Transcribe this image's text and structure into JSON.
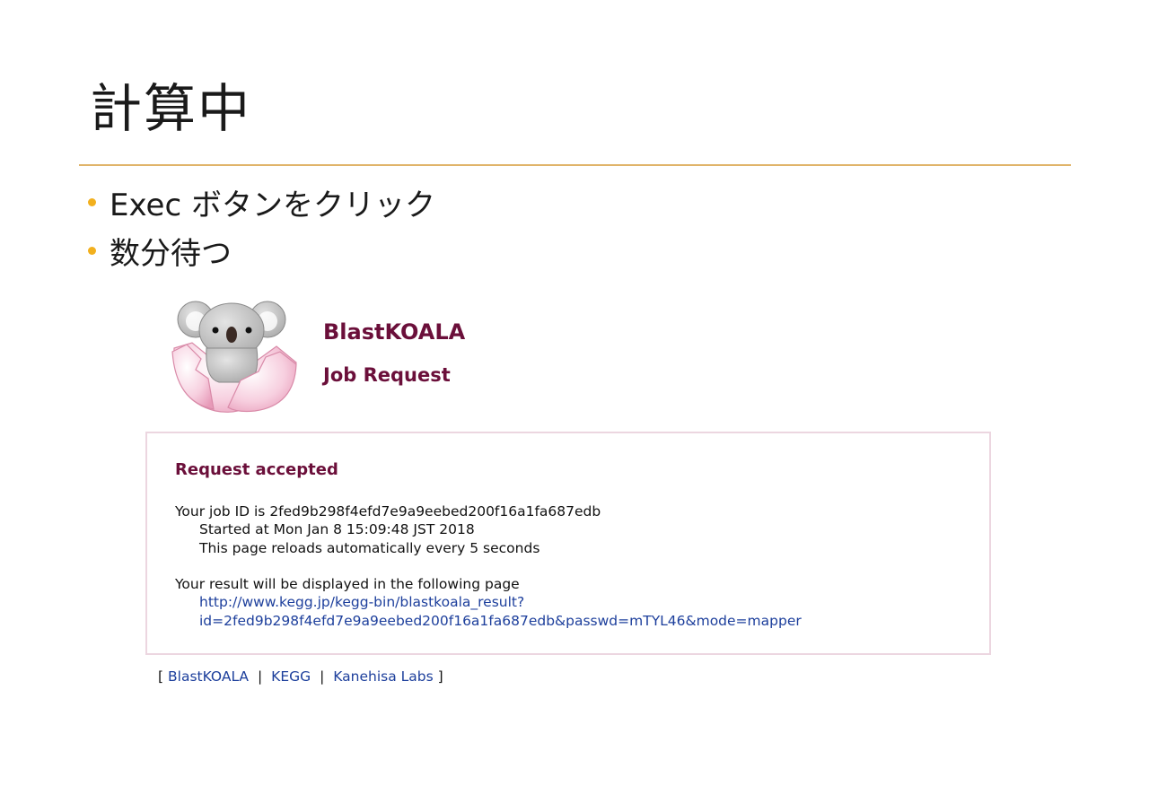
{
  "slide": {
    "title": "計算中",
    "bullets": [
      "Exec ボタンをクリック",
      "数分待つ"
    ]
  },
  "app": {
    "name": "BlastKOALA",
    "page": "Job Request",
    "logo_icon": "koala-egg-icon"
  },
  "result": {
    "heading": "Request accepted",
    "job_id_line": "Your job ID is 2fed9b298f4efd7e9a9eebed200f16a1fa687edb",
    "started_line": "Started at Mon Jan 8 15:09:48 JST 2018",
    "reload_line": "This page reloads automatically every 5 seconds",
    "result_intro": "Your result will be displayed in the following page",
    "result_link_line1": "http://www.kegg.jp/kegg-bin/blastkoala_result?",
    "result_link_line2": "id=2fed9b298f4efd7e9a9eebed200f16a1fa687edb&passwd=mTYL46&mode=mapper"
  },
  "footer": {
    "open_bracket": "[",
    "close_bracket": "]",
    "separator": "|",
    "links": [
      "BlastKOALA",
      "KEGG",
      "Kanehisa Labs"
    ]
  },
  "colors": {
    "accent_rule": "#e0b46a",
    "bullet": "#f2b01e",
    "kegg_maroon": "#6b0f3a",
    "link_blue": "#1d3f9c",
    "box_border": "#ecd6e0"
  }
}
